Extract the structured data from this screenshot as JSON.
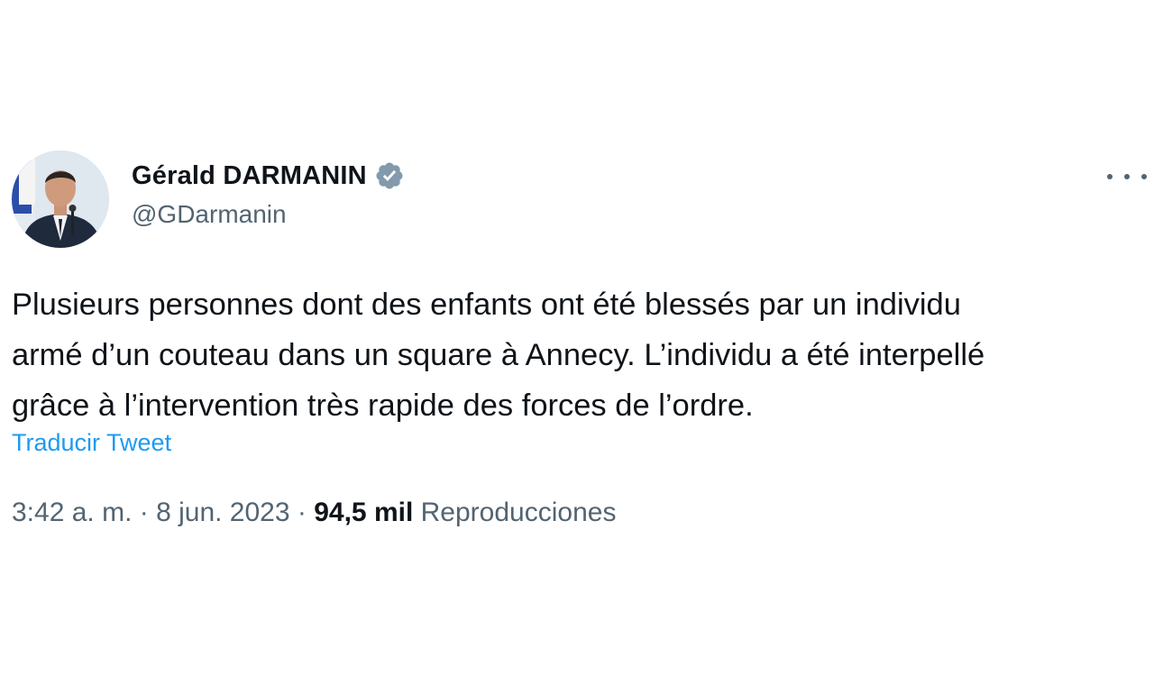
{
  "author": {
    "display_name": "Gérald DARMANIN",
    "handle": "@GDarmanin",
    "verified_badge_color": "#829aab"
  },
  "tweet": {
    "lines": [
      "Plusieurs personnes dont des enfants ont été blessés par un individu",
      "armé d’un couteau dans un square à Annecy. L’individu a été interpellé",
      "grâce à l’intervention très rapide des forces de l’ordre."
    ],
    "translate_label": "Traducir Tweet"
  },
  "meta": {
    "time": "3:42 a. m.",
    "separator": " · ",
    "date": "8 jun. 2023",
    "views_count": "94,5 mil",
    "views_label": "Reproducciones"
  },
  "icons": {
    "more": "more-horizontal-icon",
    "verified": "verified-badge-icon"
  },
  "colors": {
    "text": "#0f1419",
    "secondary": "#536471",
    "link": "#1d9bf0"
  }
}
